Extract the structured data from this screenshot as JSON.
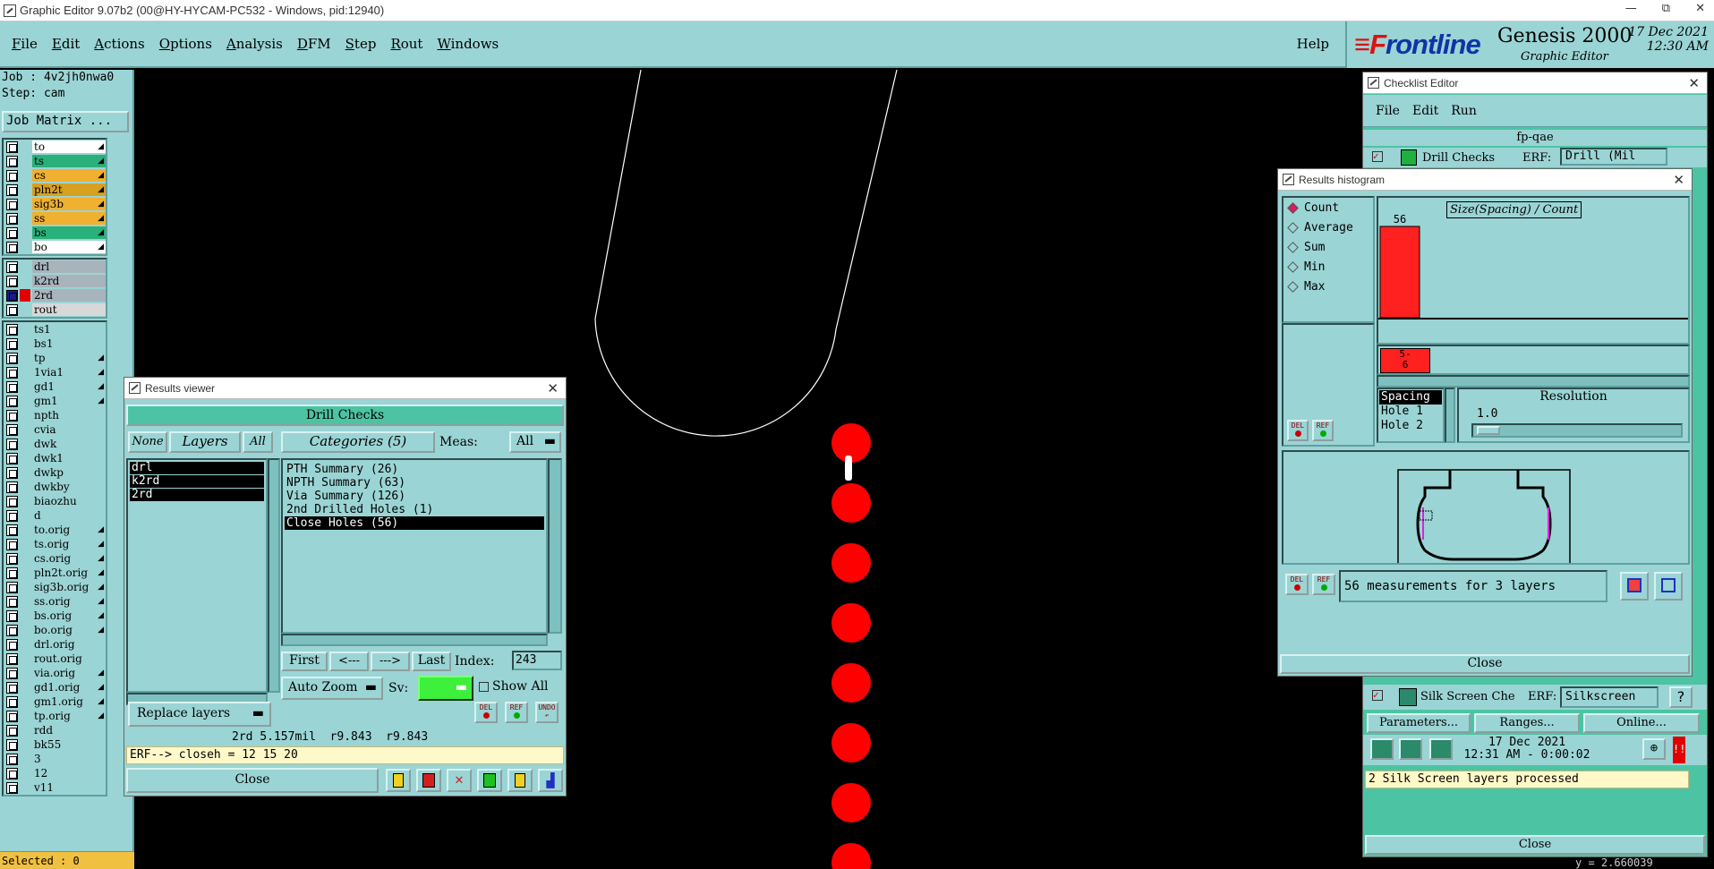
{
  "window": {
    "title": "Graphic Editor 9.07b2 (00@HY-HYCAM-PC532 - Windows, pid:12940)",
    "min": "—",
    "max": "⧉",
    "close": "✕"
  },
  "menu": {
    "items": [
      "File",
      "Edit",
      "Actions",
      "Options",
      "Analysis",
      "DFM",
      "Step",
      "Rout",
      "Windows"
    ],
    "help": "Help"
  },
  "logo": {
    "brand_f": "≡F",
    "brand_rest": "rontline",
    "product": "Genesis 2000",
    "subtitle": "Graphic Editor",
    "date": "17 Dec 2021",
    "time": "12:30 AM"
  },
  "left": {
    "job": "Job : 4v2jh0nwa0",
    "step": "Step: cam",
    "job_matrix": "Job Matrix ...",
    "selected": "Selected : 0",
    "group1": [
      {
        "name": "to",
        "color": "#ffffff",
        "tick": true
      },
      {
        "name": "ts",
        "color": "#2ab07a",
        "tick": true
      },
      {
        "name": "cs",
        "color": "#f0b030",
        "tick": true
      },
      {
        "name": "pln2t",
        "color": "#d8a020",
        "tick": true
      },
      {
        "name": "sig3b",
        "color": "#f0b030",
        "tick": true
      },
      {
        "name": "ss",
        "color": "#f0b030",
        "tick": true
      },
      {
        "name": "bs",
        "color": "#2ab07a",
        "tick": true
      },
      {
        "name": "bo",
        "color": "#ffffff",
        "tick": true
      }
    ],
    "group2": [
      {
        "name": "drl",
        "color": "#a8b4bc",
        "tick": false
      },
      {
        "name": "k2rd",
        "color": "#a8b4bc",
        "tick": false
      },
      {
        "name": "2rd",
        "color": "#a8b4bc",
        "tick": false,
        "on": true
      },
      {
        "name": "rout",
        "color": "#d8d8d8",
        "tick": false
      }
    ],
    "group3": [
      {
        "name": "ts1",
        "tick": false
      },
      {
        "name": "bs1",
        "tick": false
      },
      {
        "name": "tp",
        "tick": true
      },
      {
        "name": "1via1",
        "tick": true
      },
      {
        "name": "gd1",
        "tick": true
      },
      {
        "name": "gm1",
        "tick": true
      },
      {
        "name": "npth",
        "tick": false
      },
      {
        "name": "cvia",
        "tick": false
      },
      {
        "name": "dwk",
        "tick": false
      },
      {
        "name": "dwk1",
        "tick": false
      },
      {
        "name": "dwkp",
        "tick": false
      },
      {
        "name": "dwkby",
        "tick": false
      },
      {
        "name": "biaozhu",
        "tick": false
      },
      {
        "name": "d",
        "tick": false
      },
      {
        "name": "to.orig",
        "tick": true
      },
      {
        "name": "ts.orig",
        "tick": true
      },
      {
        "name": "cs.orig",
        "tick": true
      },
      {
        "name": "pln2t.orig",
        "tick": true
      },
      {
        "name": "sig3b.orig",
        "tick": true
      },
      {
        "name": "ss.orig",
        "tick": true
      },
      {
        "name": "bs.orig",
        "tick": true
      },
      {
        "name": "bo.orig",
        "tick": true
      },
      {
        "name": "drl.orig",
        "tick": false
      },
      {
        "name": "rout.orig",
        "tick": false
      },
      {
        "name": "via.orig",
        "tick": true
      },
      {
        "name": "gd1.orig",
        "tick": true
      },
      {
        "name": "gm1.orig",
        "tick": true
      },
      {
        "name": "tp.orig",
        "tick": true
      },
      {
        "name": "rdd",
        "tick": false
      },
      {
        "name": "bk55",
        "tick": false
      },
      {
        "name": "3",
        "tick": false
      },
      {
        "name": "12",
        "tick": false
      },
      {
        "name": "v11",
        "tick": false
      }
    ]
  },
  "results_viewer": {
    "title": "Results viewer",
    "header": "Drill Checks",
    "none_btn": "None",
    "layers_btn": "Layers",
    "all_btn": "All",
    "categories_btn": "Categories (5)",
    "meas_label": "Meas:",
    "meas_value": "All",
    "layers": [
      "drl",
      "k2rd",
      "2rd"
    ],
    "categories": [
      "PTH Summary (26)",
      "NPTH Summary (63)",
      "Via Summary (126)",
      "2nd Drilled Holes (1)",
      "Close Holes (56)"
    ],
    "selected_category": 4,
    "first": "First",
    "prev": "<---",
    "next": "--->",
    "last": "Last",
    "index_label": "Index:",
    "index_value": "243",
    "auto_zoom": "Auto Zoom",
    "sv_label": "Sv:",
    "show_all": "Show All",
    "replace_layers": "Replace layers",
    "del": "DEL",
    "ref": "REF",
    "undo": "UNDO",
    "status": "2rd 5.157mil  r9.843  r9.843",
    "erf": "ERF--> closeh = 12 15 20",
    "close": "Close"
  },
  "checklist": {
    "title": "Checklist Editor",
    "menu": [
      "File",
      "Edit",
      "Run"
    ],
    "name": "fp-qae",
    "row1_label": "Drill Checks",
    "row1_erf": "ERF:",
    "row1_erf_value": "Drill (Mil",
    "silk_label": "Silk Screen Che",
    "silk_erf": "ERF:",
    "silk_erf_value": "Silkscreen",
    "params": "Parameters...",
    "ranges": "Ranges...",
    "online": "Online...",
    "run_date": "17 Dec 2021",
    "run_time": "12:31 AM - 0:00:02",
    "message": "2 Silk Screen layers processed",
    "close": "Close",
    "coord": "y = 2.660039"
  },
  "histogram": {
    "title": "Results histogram",
    "options": [
      "Count",
      "Average",
      "Sum",
      "Min",
      "Max"
    ],
    "selected_option": 0,
    "chart_title": "Size(Spacing) / Count",
    "bar_value": "56",
    "bar_label": "5-\n6",
    "list": [
      "Spacing",
      "Hole 1",
      "Hole 2"
    ],
    "resolution_label": "Resolution",
    "resolution_value": "1.0",
    "measurements": "56 measurements for 3 layers",
    "close": "Close",
    "del": "DEL",
    "ref": "REF"
  },
  "chart_data": {
    "type": "bar",
    "title": "Size(Spacing) / Count",
    "categories": [
      "5-6"
    ],
    "values": [
      56
    ]
  },
  "colors": {
    "panel": "#9bd4d4",
    "panel_dark": "#5fa0a0",
    "accent_green": "#4cc4a4",
    "drill_red": "#ff0000"
  }
}
